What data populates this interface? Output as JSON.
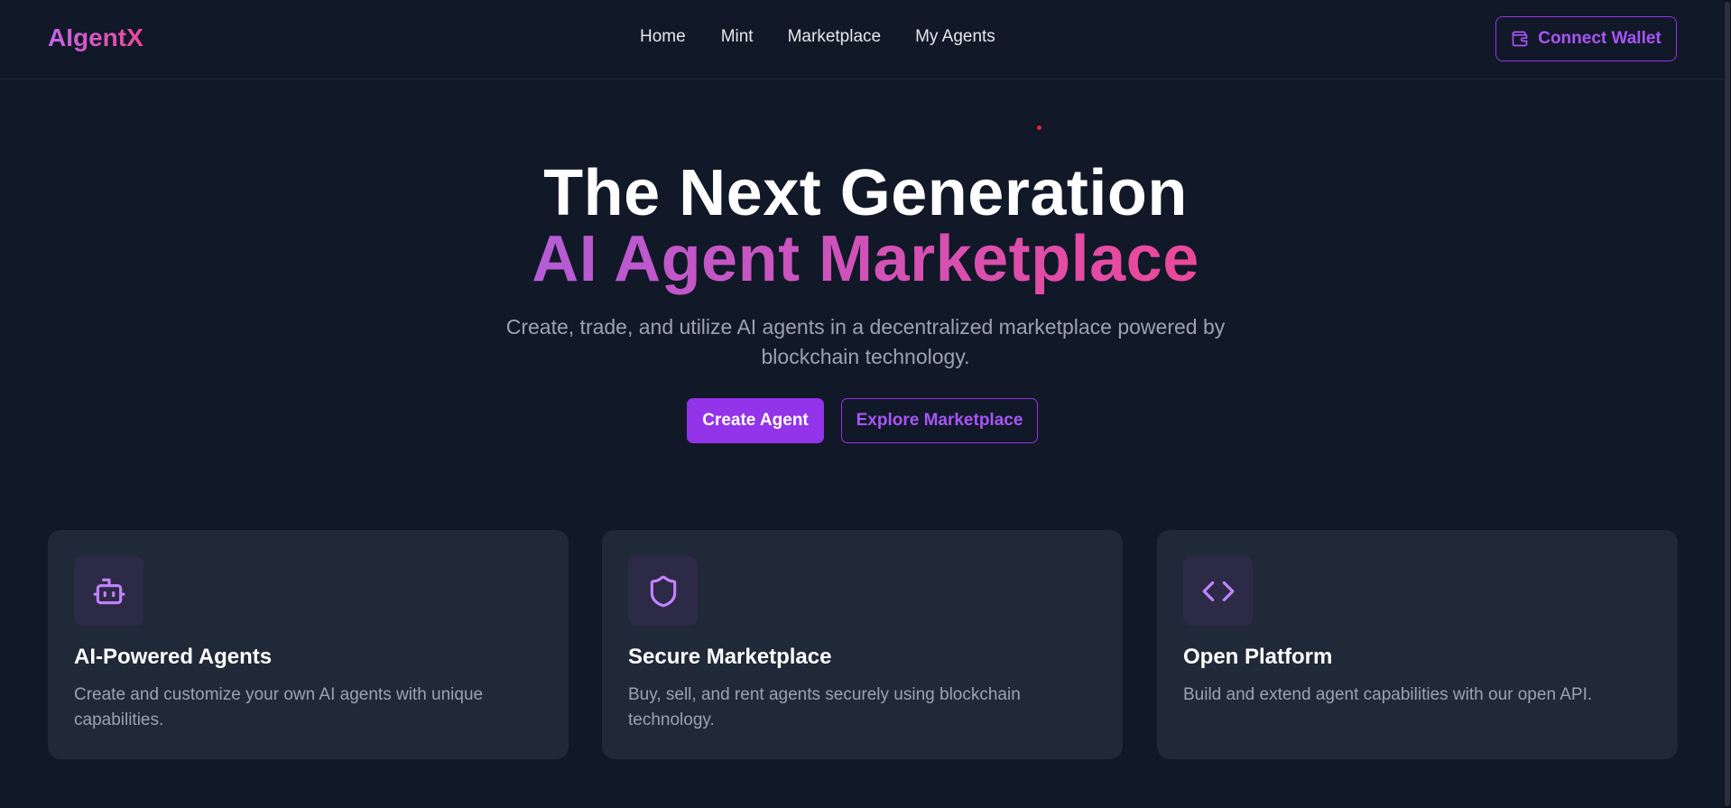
{
  "header": {
    "logo": "AIgentX",
    "nav": [
      "Home",
      "Mint",
      "Marketplace",
      "My Agents"
    ],
    "connect_wallet": "Connect Wallet",
    "wallet_icon": "wallet-icon"
  },
  "hero": {
    "line1": "The Next Generation",
    "line2": "AI Agent Marketplace",
    "subtitle": "Create, trade, and utilize AI agents in a decentralized marketplace powered by blockchain technology.",
    "primary_button": "Create Agent",
    "secondary_button": "Explore Marketplace"
  },
  "features": [
    {
      "icon": "robot-icon",
      "title": "AI-Powered Agents",
      "description": "Create and customize your own AI agents with unique capabilities."
    },
    {
      "icon": "shield-icon",
      "title": "Secure Marketplace",
      "description": "Buy, sell, and rent agents securely using blockchain technology."
    },
    {
      "icon": "code-icon",
      "title": "Open Platform",
      "description": "Build and extend agent capabilities with our open API."
    }
  ],
  "colors": {
    "background": "#111827",
    "card": "#1f2937",
    "accent": "#9333ea",
    "gradient_start": "#c066e6",
    "gradient_end": "#ec4899",
    "muted_text": "#9ca3af"
  }
}
